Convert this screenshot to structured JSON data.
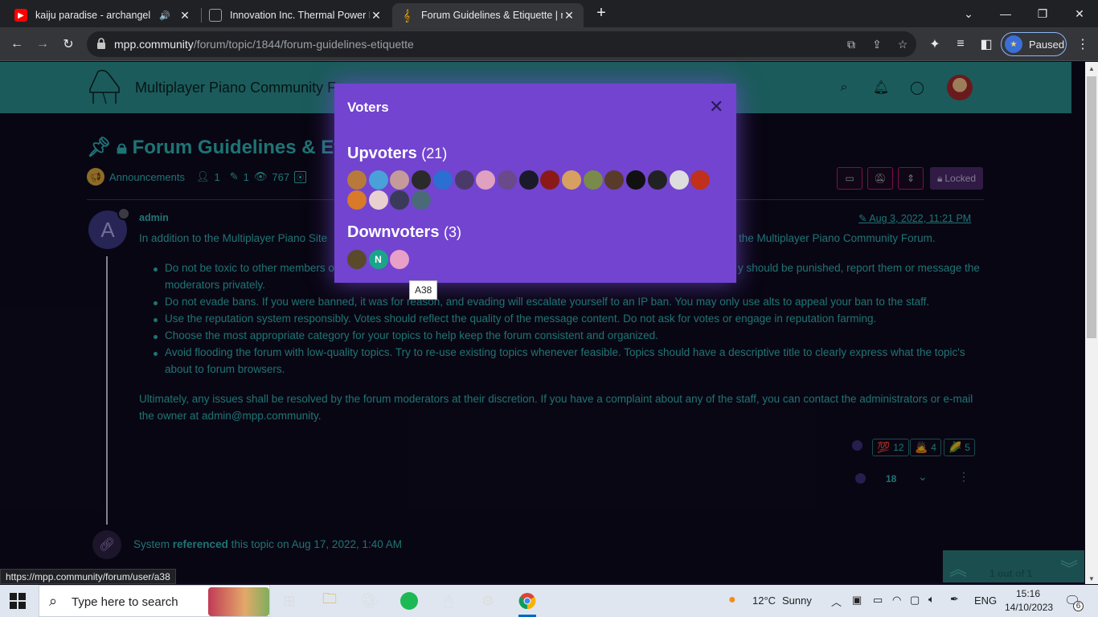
{
  "browser": {
    "tabs": [
      {
        "title": "kaiju paradise - archangel th",
        "favicon_color": "#ff0000",
        "icon": "youtube-icon"
      },
      {
        "title": "Innovation Inc. Thermal Power P",
        "favicon_color": "#9aa0a6",
        "icon": "page-icon"
      },
      {
        "title": "Forum Guidelines & Etiquette | r",
        "favicon_color": "#f9ab00",
        "icon": "music-note-icon",
        "active": true
      }
    ],
    "url_host": "mpp.community",
    "url_path": "/forum/topic/1844/forum-guidelines-etiquette",
    "profile_label": "Paused"
  },
  "site": {
    "header_title": "Multiplayer Piano Community Fo",
    "accent": "#2fb3b3",
    "header_bg": "#2a8c8c"
  },
  "topic": {
    "title": "Forum Guidelines & Etiqu",
    "category": "Announcements",
    "posters": "1",
    "posts": "1",
    "views": "767",
    "locked_label": "Locked"
  },
  "post": {
    "avatar_letter": "A",
    "author": "admin",
    "date": "Aug 3, 2022, 11:21 PM",
    "intro_left": "In addition to the Multiplayer Piano Site",
    "intro_right": "the Multiplayer Piano Community Forum.",
    "bullet1_left": "Do not be toxic to other members o",
    "bullet1_right": "y should be punished, report them or message the",
    "bullet1_cont": "moderators privately.",
    "bullet2_a": "Do not evade bans. If you were banned, it was for ",
    "bullet2_b": "reason, and evading will escalate yourself to an IP ban. You may only use alts to appeal your ban to the staff.",
    "bullet3": "Use the reputation system responsibly. Votes should reflect the quality of the message content. Do not ask for votes or engage in reputation farming.",
    "bullet4": "Choose the most appropriate category for your topics to help keep the forum consistent and organized.",
    "bullet5": "Avoid flooding the forum with low-quality topics. Try to re-use existing topics whenever feasible. Topics should have a descriptive title to clearly express what the topic's",
    "bullet5_cont": "about to forum browsers.",
    "closing1": "Ultimately, any issues shall be resolved by the forum moderators at their discretion. If you have a complaint about any of the staff, you can contact the administrators or e-mail",
    "closing2": "the owner at admin@mpp.community.",
    "reactions": [
      {
        "emoji": "💯",
        "count": "12"
      },
      {
        "emoji": "🙇",
        "count": "4"
      },
      {
        "emoji": "🌽",
        "count": "5"
      }
    ],
    "votes": "18"
  },
  "system_ref": {
    "actor": "System",
    "action": "referenced",
    "rest": "this topic on Aug 17, 2022, 1:40 AM"
  },
  "navigator": {
    "count": "1 out of 1"
  },
  "status_url": "https://mpp.community/forum/user/a38",
  "modal": {
    "title": "Voters",
    "upvoters_label": "Upvoters",
    "upvoters_count": "(21)",
    "downvoters_label": "Downvoters",
    "downvoters_count": "(3)",
    "upvoter_colors": [
      "#b87a3a",
      "#4aa0d8",
      "#c59a9a",
      "#2a2a2a",
      "#2a6fd1",
      "#4a3a6a",
      "#e0a0c0",
      "#6a4a8a",
      "#1a1a2a",
      "#8a1a1a",
      "#d8a060",
      "#7a8a4a",
      "#5a3a2a",
      "#111111",
      "#222222",
      "#dddddd",
      "#c0301a",
      "#d87a2a",
      "#e8d0d0",
      "#3a3a5a",
      "#4a6a7a"
    ],
    "downvoter_colors": [
      "#5a4a2a",
      "#1aa58a",
      "#e8a0c8"
    ],
    "downvoter_letter": "N",
    "tooltip": "A38"
  },
  "taskbar": {
    "search_placeholder": "Type here to search",
    "weather_temp": "12°C",
    "weather_text": "Sunny",
    "lang": "ENG",
    "time": "15:16",
    "date": "14/10/2023",
    "notif_count": "6"
  }
}
